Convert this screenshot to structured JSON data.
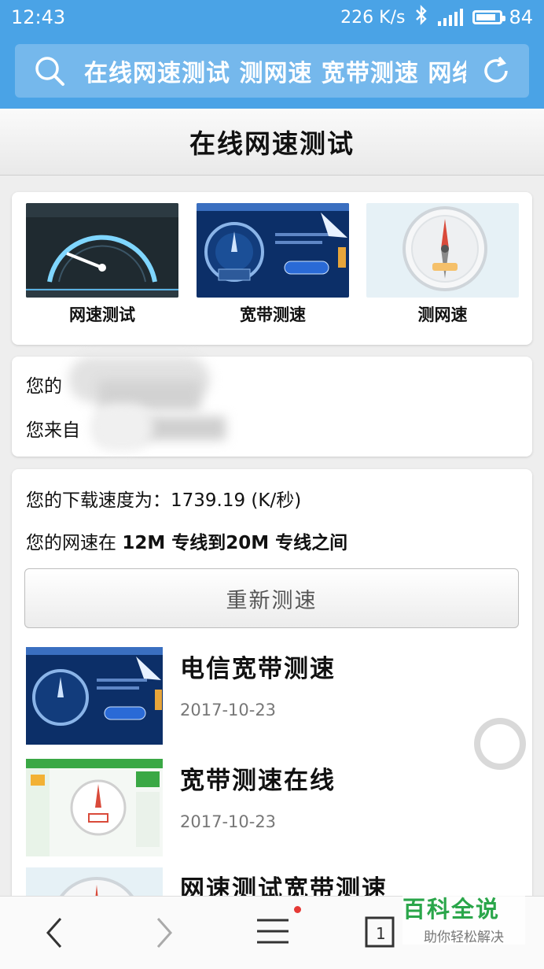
{
  "status_bar": {
    "time": "12:43",
    "net_speed": "226 K/s",
    "battery": "84",
    "battery_level": 0.84,
    "network": "4G"
  },
  "address_bar": {
    "query": "在线网速测试 测网速 宽带测速 网络"
  },
  "page": {
    "title": "在线网速测试"
  },
  "tools": [
    {
      "label": "网速测试"
    },
    {
      "label": "宽带测速"
    },
    {
      "label": "测网速"
    }
  ],
  "user_info": {
    "ip_prefix": "您的",
    "from_prefix": "您来自"
  },
  "result": {
    "download_label": "您的下载速度为：",
    "download_value": "1739.19 (K/秒)",
    "range_prefix": "您的网速在",
    "range_text": "12M 专线到20M 专线之间",
    "retest_label": "重新测速"
  },
  "articles": [
    {
      "title": "电信宽带测速",
      "date": "2017-10-23"
    },
    {
      "title": "宽带测速在线",
      "date": "2017-10-23"
    },
    {
      "title": "网速测试宽带测速",
      "date": ""
    }
  ],
  "watermark": {
    "title": "百科全说",
    "subtitle": "助你轻松解决"
  },
  "colors": {
    "accent": "#4aa3e6",
    "watermark_green": "#2aa64a"
  }
}
